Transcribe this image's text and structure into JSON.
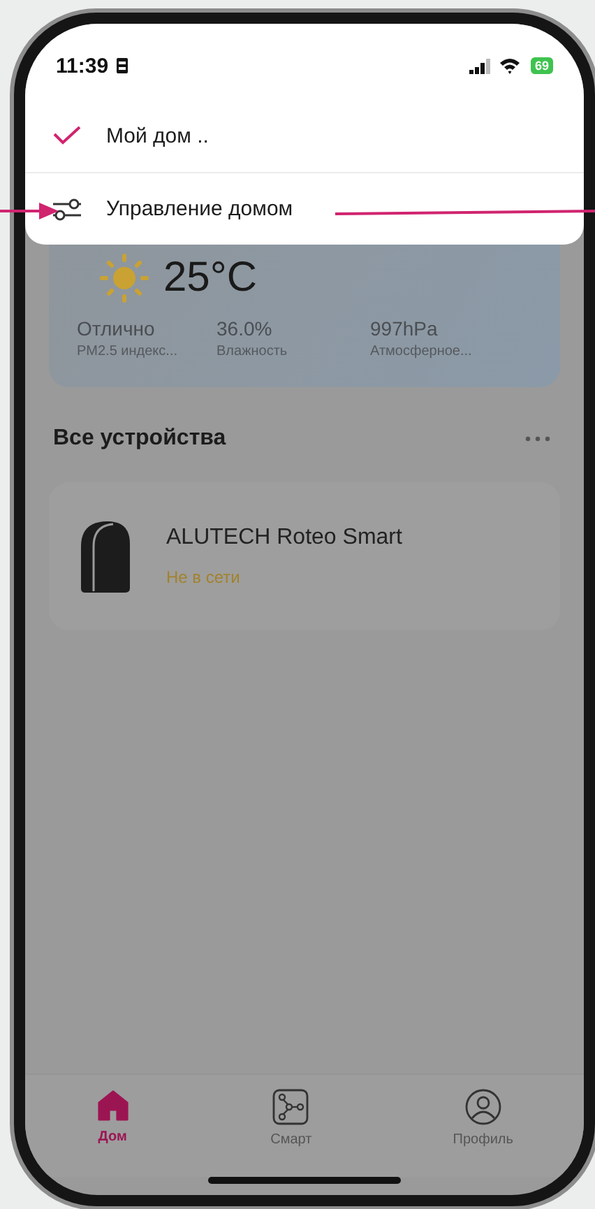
{
  "status_bar": {
    "time": "11:39",
    "battery": "69"
  },
  "menu": {
    "items": [
      {
        "kind": "home",
        "label": "Мой дом ..",
        "selected": true
      },
      {
        "kind": "manage",
        "label": "Управление домом",
        "selected": false
      }
    ]
  },
  "weather": {
    "temperature": "25°C",
    "stats": [
      {
        "value": "Отлично",
        "label": "PM2.5 индекс..."
      },
      {
        "value": "36.0%",
        "label": "Влажность"
      },
      {
        "value": "997hPa",
        "label": "Атмосферное..."
      }
    ]
  },
  "devices": {
    "title": "Все устройства",
    "items": [
      {
        "name": "ALUTECH Roteo Smart",
        "status": "Не в сети"
      }
    ]
  },
  "tab_bar": {
    "tabs": [
      {
        "kind": "home",
        "label": "Дом",
        "selected": true
      },
      {
        "kind": "smart",
        "label": "Смарт",
        "selected": false
      },
      {
        "kind": "profile",
        "label": "Профиль",
        "selected": false
      }
    ]
  }
}
